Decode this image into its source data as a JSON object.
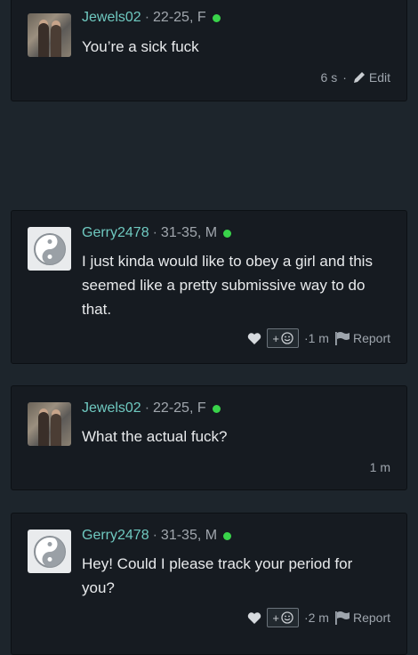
{
  "messages": [
    {
      "username": "Jewels02",
      "sep": "·",
      "info": "22-25, F",
      "text": "You’re a sick fuck",
      "time": "6 s",
      "time_sep": "·",
      "action": "Edit"
    },
    {
      "username": "Gerry2478",
      "sep": "·",
      "info": "31-35, M",
      "text": "I just kinda would like to obey a girl and this seemed like a pretty submissive way to do that.",
      "react": "+",
      "time": "·1 m",
      "action": "Report"
    },
    {
      "username": "Jewels02",
      "sep": "·",
      "info": "22-25, F",
      "text": "What the actual fuck?",
      "time": "1 m"
    },
    {
      "username": "Gerry2478",
      "sep": "·",
      "info": "31-35, M",
      "text": "Hey! Could I please track your period for you?",
      "react": "+",
      "time": "·2 m",
      "action": "Report"
    }
  ],
  "colors": {
    "background": "#1d252c",
    "card": "#161b21",
    "username": "#6fc9c0",
    "online": "#39d34a"
  }
}
